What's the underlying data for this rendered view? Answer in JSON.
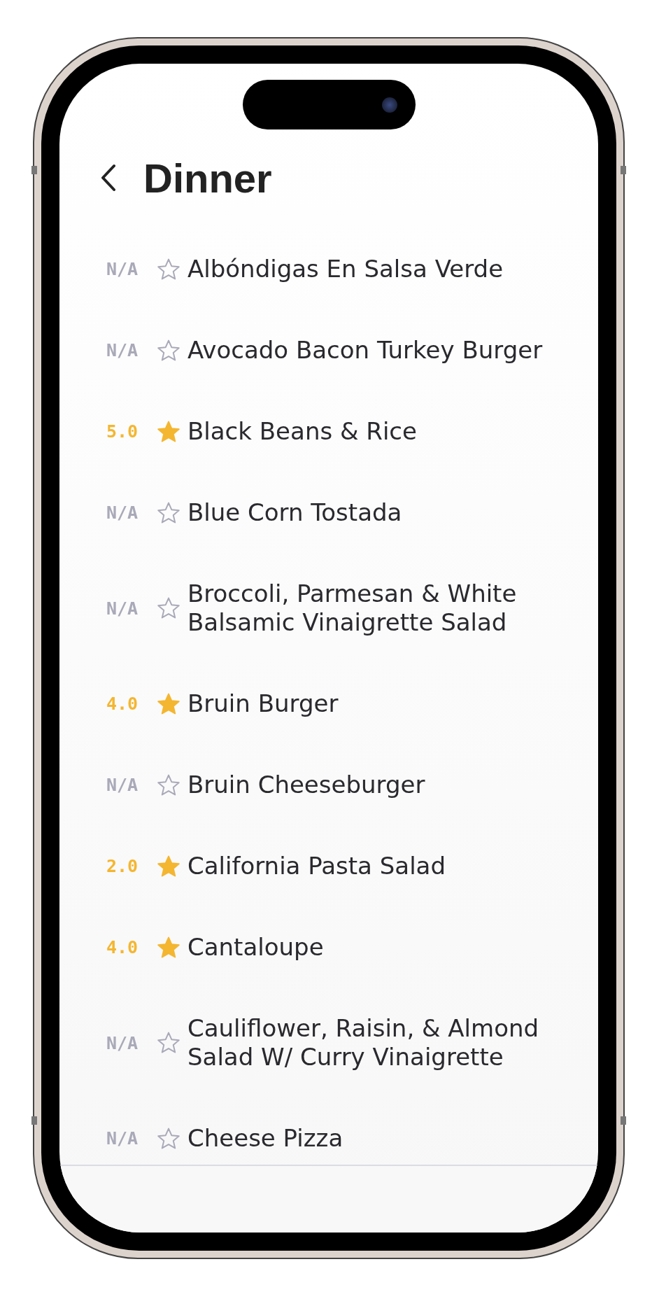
{
  "header": {
    "title": "Dinner"
  },
  "items": [
    {
      "rating": "N/A",
      "rated": false,
      "name": "Albóndigas En Salsa Verde"
    },
    {
      "rating": "N/A",
      "rated": false,
      "name": "Avocado Bacon Turkey Burger"
    },
    {
      "rating": "5.0",
      "rated": true,
      "name": "Black Beans & Rice"
    },
    {
      "rating": "N/A",
      "rated": false,
      "name": "Blue Corn Tostada"
    },
    {
      "rating": "N/A",
      "rated": false,
      "name": "Broccoli, Parmesan & White Balsamic Vinaigrette Salad"
    },
    {
      "rating": "4.0",
      "rated": true,
      "name": "Bruin Burger"
    },
    {
      "rating": "N/A",
      "rated": false,
      "name": "Bruin Cheeseburger"
    },
    {
      "rating": "2.0",
      "rated": true,
      "name": "California Pasta Salad"
    },
    {
      "rating": "4.0",
      "rated": true,
      "name": "Cantaloupe"
    },
    {
      "rating": "N/A",
      "rated": false,
      "name": "Cauliflower, Raisin, & Almond Salad W/ Curry Vinaigrette"
    },
    {
      "rating": "N/A",
      "rated": false,
      "name": "Cheese Pizza"
    }
  ]
}
